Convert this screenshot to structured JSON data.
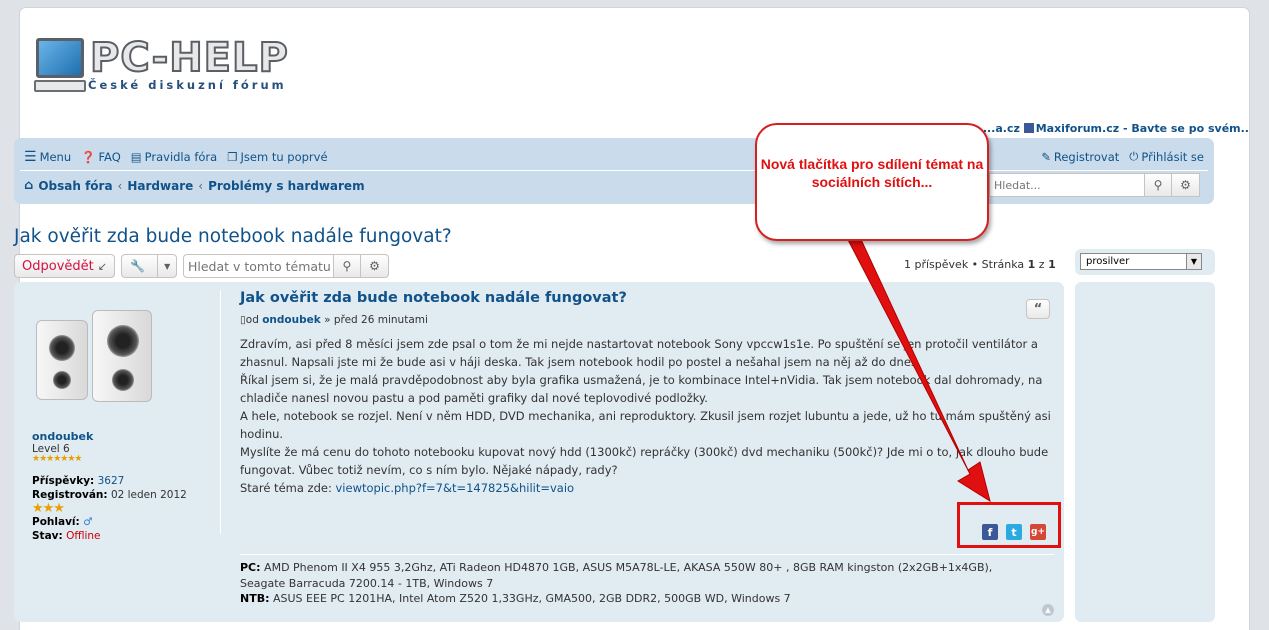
{
  "logo": {
    "title": "PC-HELP",
    "subtitle": "České diskuzní fórum"
  },
  "toplinks": {
    "left": "...a.cz",
    "brand": "Maxiforum.cz",
    "tail": "- Bavte se po svém.."
  },
  "nav": {
    "menu": "Menu",
    "faq": "FAQ",
    "rules": "Pravidla fóra",
    "first": "Jsem tu poprvé",
    "register": "Registrovat",
    "login": "Přihlásit se"
  },
  "breadcrumbs": [
    "Obsah fóra",
    "Hardware",
    "Problémy s hardwarem"
  ],
  "search": {
    "placeholder": "Hledat..."
  },
  "topic": {
    "title": "Jak ověřit zda bude notebook nadále fungovat?",
    "reply_label": "Odpovědět",
    "search_placeholder": "Hledat v tomto tématu",
    "pagination": {
      "count": "1 příspěvek",
      "page_label": "Stránka",
      "page": "1",
      "of": "z",
      "total": "1"
    }
  },
  "style_select": {
    "value": "prosilver"
  },
  "post": {
    "title": "Jak ověřit zda bude notebook nadále fungovat?",
    "author_prefix": "od",
    "author": "ondoubek",
    "time": "» před 26 minutami",
    "content": [
      "Zdravím, asi před 8 měsíci jsem zde psal o tom že mi nejde nastartovat notebook Sony vpccw1s1e. Po spuštění se jen protočil ventilátor a zhasnul. Napsali jste mi že bude asi v háji deska. Tak jsem notebook hodil po postel a nešahal jsem na něj až do dnes.",
      "Říkal jsem si, že je malá pravděpodobnost aby byla grafika usmažená, je to kombinace Intel+nVidia. Tak jsem notebook dal dohromady, na chladiče nanesl novou pastu a pod paměti grafiky dal nové teplovodivé podložky.",
      "A hele, notebook se rozjel. Není v něm HDD, DVD mechanika, ani reproduktory. Zkusil jsem rozjet lubuntu a jede, už ho tu mám spuštěný asi hodinu.",
      "Myslíte že má cenu do tohoto notebooku kupovat nový hdd (1300kč) repráčky (300kč) dvd mechaniku (500kč)? Jde mi o to, jak dlouho bude fungovat. Vůbec totiž nevím, co s ním bylo. Nějaké nápady, rady?"
    ],
    "old_topic_label": "Staré téma zde:",
    "old_topic_link": "viewtopic.php?f=7&t=147825&hilit=vaio",
    "signature": {
      "pc_label": "PC:",
      "pc": "AMD Phenom II X4 955 3,2Ghz, ATi Radeon HD4870 1GB, ASUS M5A78L-LE, AKASA 550W 80+ , 8GB RAM kingston (2x2GB+1x4GB), Seagate Barracuda 7200.14 - 1TB, Windows 7",
      "ntb_label": "NTB:",
      "ntb": "ASUS EEE PC 1201HA, Intel Atom Z520 1,33GHz, GMA500, 2GB DDR2, 500GB WD, Windows 7"
    }
  },
  "profile": {
    "username": "ondoubek",
    "rank": "Level 6",
    "posts_label": "Příspěvky:",
    "posts": "3627",
    "registered_label": "Registrován:",
    "registered": "02 leden 2012",
    "thanks_label": "Pohlaví:",
    "status_label": "Stav:",
    "status": "Offline"
  },
  "annotation": {
    "text": "Nová tlačítka pro sdílení témat na sociálních sítích..."
  },
  "colors": {
    "link": "#105289",
    "nav_bg": "#cadceb",
    "post_bg": "#e1ebf2",
    "annotation": "#e01010"
  }
}
